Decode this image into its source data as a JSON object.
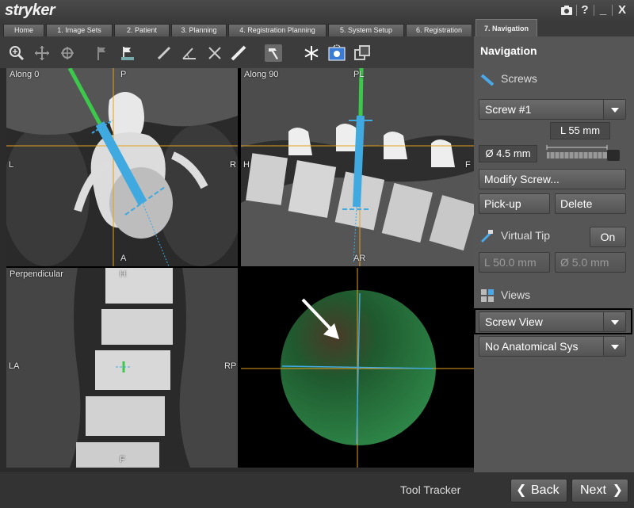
{
  "app": {
    "logo_text": "stryker",
    "window_buttons": {
      "camera": "camera-icon",
      "help": "?",
      "minimize": "_",
      "close": "X"
    }
  },
  "tabs": [
    {
      "label": "Home",
      "active": false
    },
    {
      "label": "1. Image Sets",
      "active": false
    },
    {
      "label": "2. Patient",
      "active": false
    },
    {
      "label": "3. Planning",
      "active": false
    },
    {
      "label": "4. Registration Planning",
      "active": false
    },
    {
      "label": "5. System Setup",
      "active": false
    },
    {
      "label": "6. Registration",
      "active": false
    },
    {
      "label": "7. Navigation",
      "active": true
    }
  ],
  "toolbar": {
    "tools": [
      "zoom-icon",
      "pan-icon",
      "rotate-icon",
      "flag-icon",
      "landmark-icon",
      "ruler-icon",
      "angle-icon",
      "cross-icon",
      "measure-icon",
      "hammer-icon",
      "freeze-icon",
      "camera-view-icon",
      "layers-icon"
    ]
  },
  "viewports": {
    "axial": {
      "label": "Along 0",
      "top": "P",
      "bottom": "A",
      "left": "L",
      "right": "R"
    },
    "sagittal": {
      "label": "Along 90",
      "top": "PL",
      "bottom": "AR",
      "left": "H",
      "right": "F"
    },
    "coronal": {
      "label": "Perpendicular",
      "top": "H",
      "bottom": "F",
      "left": "LA",
      "right": "RP"
    },
    "screw_view": {
      "label": ""
    }
  },
  "panel": {
    "title": "Navigation",
    "screws_section": "Screws",
    "screw_select": "Screw #1",
    "length": "L 55 mm",
    "diameter": "Ø 4.5 mm",
    "modify_button": "Modify Screw...",
    "pickup_button": "Pick-up",
    "delete_button": "Delete",
    "virtual_tip_label": "Virtual Tip",
    "virtual_tip_toggle": "On",
    "tip_length": "L 50.0 mm",
    "tip_diameter": "Ø 5.0 mm",
    "views_section": "Views",
    "view_select": "Screw View",
    "anatomical_select": "No Anatomical Sys"
  },
  "bottom": {
    "status": "Tool Tracker",
    "back_button": "Back",
    "next_button": "Next"
  },
  "colors": {
    "crosshair": "#e8a020",
    "screw": "#3fa9e0",
    "guide": "#3cc84a",
    "panel_bg": "#565656"
  }
}
